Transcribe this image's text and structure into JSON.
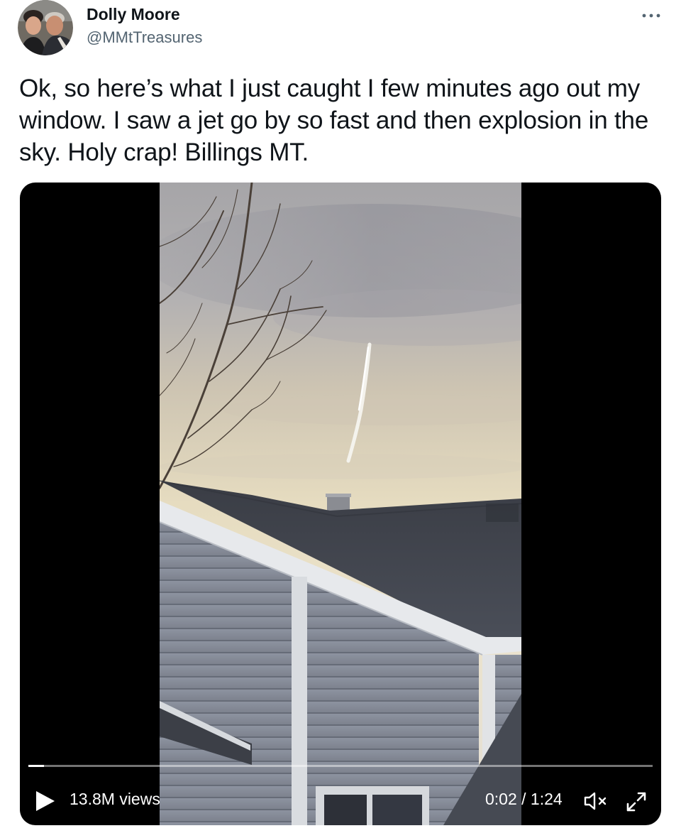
{
  "author": {
    "display_name": "Dolly Moore",
    "handle": "@MMtTreasures",
    "avatar_icon": "profile-photo-avatar"
  },
  "more_icon": "more-horizontal-icon",
  "tweet": {
    "text": "Ok, so here’s what I just caught I few minutes ago out my window. I saw a jet go by so fast and then explosion in the sky. Holy crap! Billings MT."
  },
  "video": {
    "views_label": "13.8M views",
    "time_label": "0:02 / 1:24",
    "progress_fraction": 0.025,
    "play_icon": "play-icon",
    "mute_icon": "volume-muted-icon",
    "fullscreen_icon": "fullscreen-expand-icon"
  },
  "colors": {
    "text_primary": "#0f1419",
    "text_secondary": "#536471",
    "video_background": "#000000"
  }
}
